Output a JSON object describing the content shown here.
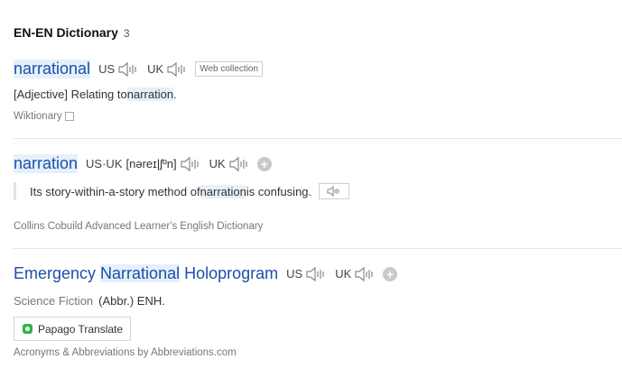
{
  "header": {
    "title": "EN-EN Dictionary",
    "count": "3"
  },
  "entries": [
    {
      "word": "narrational",
      "us_label": "US",
      "uk_label": "UK",
      "tag": "Web collection",
      "definition_prefix": "[Adjective] Relating to ",
      "definition_highlight": "narration",
      "definition_suffix": ".",
      "source": "Wiktionary"
    },
    {
      "word": "narration",
      "us_uk_label": "US·UK",
      "pronunciation": "[nəreɪ|ʃºn]",
      "uk_label": "UK",
      "example_prefix": "Its story-within-a-story method of ",
      "example_highlight": "narration",
      "example_suffix": " is confusing.",
      "source": "Collins Cobuild Advanced Learner's English Dictionary"
    },
    {
      "word_prefix": "Emergency ",
      "word_highlight": "Narrational",
      "word_suffix": " Holoprogram",
      "us_label": "US",
      "uk_label": "UK",
      "category": "Science Fiction",
      "definition": "(Abbr.) ENH.",
      "translate_button": "Papago Translate",
      "source": "Acronyms & Abbreviations by Abbreviations.com"
    }
  ],
  "icons": {
    "speaker": "speaker-icon",
    "add": "plus-icon",
    "papago": "papago-icon"
  },
  "colors": {
    "headword": "#1b4fa8",
    "highlight": "#e6f0fb",
    "papago": "#2fb54a"
  }
}
